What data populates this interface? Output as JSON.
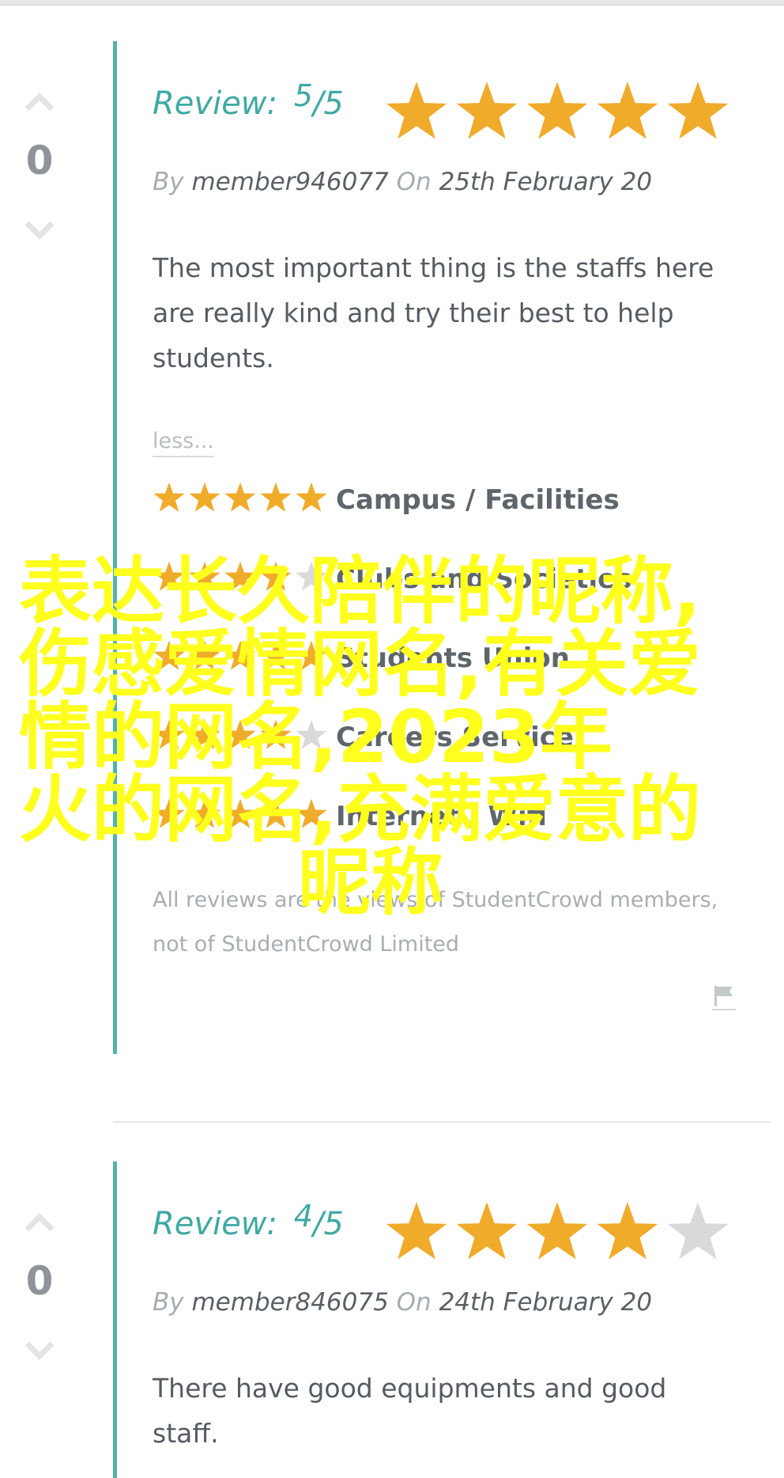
{
  "colors": {
    "accent": "#4fb3ac",
    "star_on": "#f0ab2a",
    "star_off": "#d9d9d9",
    "watermark": "#ffff1e"
  },
  "reviews": [
    {
      "votes": "0",
      "review_label": "Review:",
      "score": "5",
      "score_max": "/5",
      "rating": 5,
      "by_label": "By",
      "member": "member946077",
      "on_label": "On",
      "date": "25th February 20",
      "text": "The most important thing is the staffs here are really kind and try their best to help students.",
      "less_link": "less...",
      "categories": [
        {
          "name": "Campus / Facilities",
          "rating": 5
        },
        {
          "name": "Clubs and Societies",
          "rating": 4
        },
        {
          "name": "Students Union",
          "rating": 5
        },
        {
          "name": "Careers Service",
          "rating": 4
        },
        {
          "name": "Internet / Wifi",
          "rating": 5
        }
      ],
      "disclaimer": "All reviews are the views of StudentCrowd members, not of StudentCrowd Limited",
      "flag_icon": "flag-icon"
    },
    {
      "votes": "0",
      "review_label": "Review:",
      "score": "4",
      "score_max": "/5",
      "rating": 4,
      "by_label": "By",
      "member": "member846075",
      "on_label": "On",
      "date": "24th February 20",
      "text": "There have good equipments and good staff."
    }
  ],
  "watermark": {
    "line1": "表达长久陪伴的昵称,",
    "line2": "伤感爱情网名,有关爱",
    "line3": "情的网名,2023年",
    "line4": "火的网名,充满爱意的",
    "line5": "昵称"
  }
}
